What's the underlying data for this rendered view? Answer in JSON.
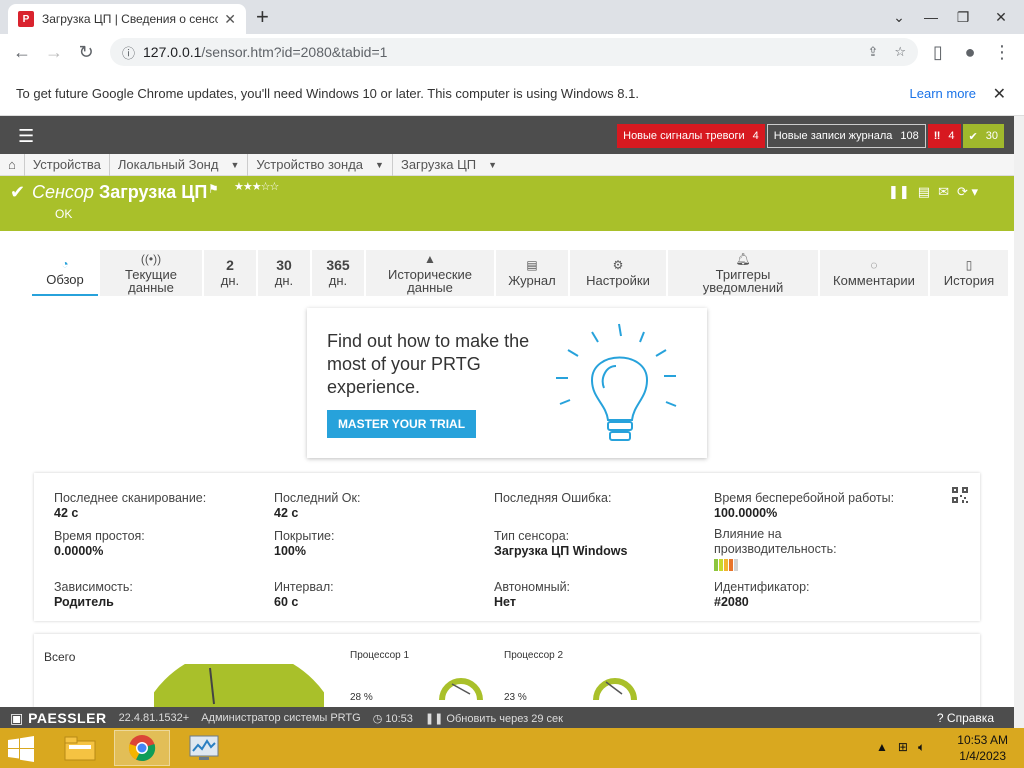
{
  "browser": {
    "tab_title": "Загрузка ЦП | Сведения о сенсоре",
    "favicon_letter": "P",
    "url_host": "127.0.0.1",
    "url_path": "/sensor.htm?id=2080&tabid=1",
    "infobar_text": "To get future Google Chrome updates, you'll need Windows 10 or later. This computer is using Windows 8.1.",
    "infobar_link": "Learn more"
  },
  "header": {
    "alarms_label": "Новые сигналы тревоги",
    "alarms_count": "4",
    "log_label": "Новые записи журнала",
    "log_count": "108",
    "down_count": "4",
    "up_count": "30"
  },
  "breadcrumb": {
    "items": [
      "Устройства",
      "Локальный Зонд",
      "Устройство зонда",
      "Загрузка ЦП"
    ]
  },
  "sensor": {
    "prefix": "Сенсор",
    "name": "Загрузка ЦП",
    "status": "OK"
  },
  "tabs": [
    {
      "icon": "gauge-icon",
      "label": "Обзор"
    },
    {
      "icon": "radio-icon",
      "label1": "Текущие",
      "label2": "данные"
    },
    {
      "big": "2",
      "label": "дн."
    },
    {
      "big": "30",
      "label": "дн."
    },
    {
      "big": "365",
      "label": "дн."
    },
    {
      "icon": "area-chart-icon",
      "label1": "Исторические",
      "label2": "данные"
    },
    {
      "icon": "list-icon",
      "label": "Журнал"
    },
    {
      "icon": "gear-icon",
      "label": "Настройки"
    },
    {
      "icon": "bell-icon",
      "label1": "Триггеры",
      "label2": "уведомлений"
    },
    {
      "icon": "comment-icon",
      "label": "Комментарии"
    },
    {
      "icon": "history-icon",
      "label": "История"
    }
  ],
  "promo": {
    "text": "Find out how to make the most of your PRTG experience.",
    "button": "MASTER YOUR TRIAL"
  },
  "info": {
    "last_scan_label": "Последнее сканирование:",
    "last_scan": "42 с",
    "last_ok_label": "Последний Ок:",
    "last_ok": "42 с",
    "last_error_label": "Последняя Ошибка:",
    "uptime_label": "Время бесперебойной работы:",
    "uptime": "100.0000%",
    "downtime_label": "Время простоя:",
    "downtime": "0.0000%",
    "coverage_label": "Покрытие:",
    "coverage": "100%",
    "sensor_type_label": "Тип сенсора:",
    "sensor_type": "Загрузка ЦП Windows",
    "impact_label1": "Влияние на",
    "impact_label2": "производительность:",
    "dependency_label": "Зависимость:",
    "dependency": "Родитель",
    "interval_label": "Интервал:",
    "interval": "60 с",
    "autonomous_label": "Автономный:",
    "autonomous": "Нет",
    "id_label": "Идентификатор:",
    "id": "#2080"
  },
  "gauges": {
    "total_label": "Всего",
    "cpu1_label": "Процессор 1",
    "cpu1_value": "28 %",
    "cpu2_label": "Процессор 2",
    "cpu2_value": "23 %"
  },
  "footer": {
    "logo": "PAESSLER",
    "version": "22.4.81.1532+",
    "user": "Администратор системы PRTG",
    "time": "10:53",
    "refresh": "Обновить через 29 сек",
    "help": "Справка"
  },
  "taskbar": {
    "time": "10:53 AM",
    "date": "1/4/2023"
  },
  "colors": {
    "sensor_ok": "#a9c02a",
    "alarm_red": "#d71920",
    "accent_blue": "#27a2db"
  }
}
